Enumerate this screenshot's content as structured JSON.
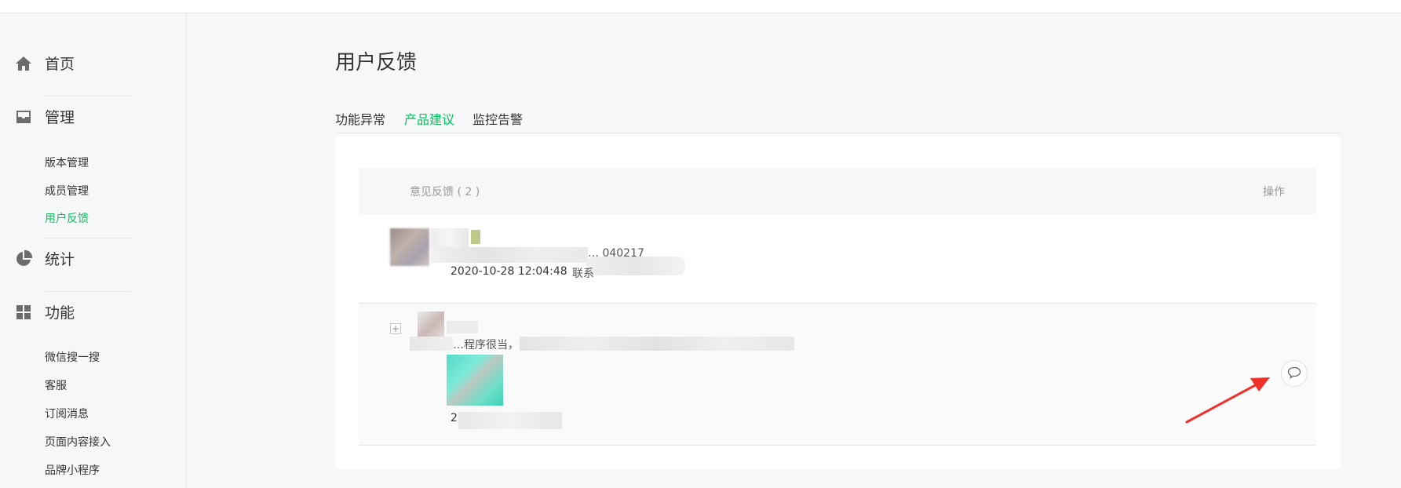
{
  "sidebar": {
    "groups": [
      {
        "label": "首页",
        "icon": "home-icon"
      },
      {
        "label": "管理",
        "icon": "inbox-icon",
        "items": [
          "版本管理",
          "成员管理",
          "用户反馈"
        ]
      },
      {
        "label": "统计",
        "icon": "pie-chart-icon"
      },
      {
        "label": "功能",
        "icon": "grid-icon",
        "items": [
          "微信搜一搜",
          "客服",
          "订阅消息",
          "页面内容接入",
          "品牌小程序"
        ]
      }
    ],
    "active_item": "用户反馈"
  },
  "page": {
    "title": "用户反馈",
    "tabs": [
      {
        "label": "功能异常",
        "active": false
      },
      {
        "label": "产品建议",
        "active": true
      },
      {
        "label": "监控告警",
        "active": false
      }
    ]
  },
  "table": {
    "header_title": "意见反馈 ( 2 )",
    "header_action": "操作",
    "rows": [
      {
        "partial_text": "… 040217",
        "timestamp": "2020-10-28 12:04:48",
        "trailing_text": "联系"
      },
      {
        "partial_text": "…程序很当，",
        "timestamp": "2",
        "reply_icon": "comment-icon"
      }
    ]
  },
  "colors": {
    "accent": "#07c160",
    "annotation_arrow": "#f0312a",
    "text": "#353535",
    "muted": "#9a9a9a"
  }
}
